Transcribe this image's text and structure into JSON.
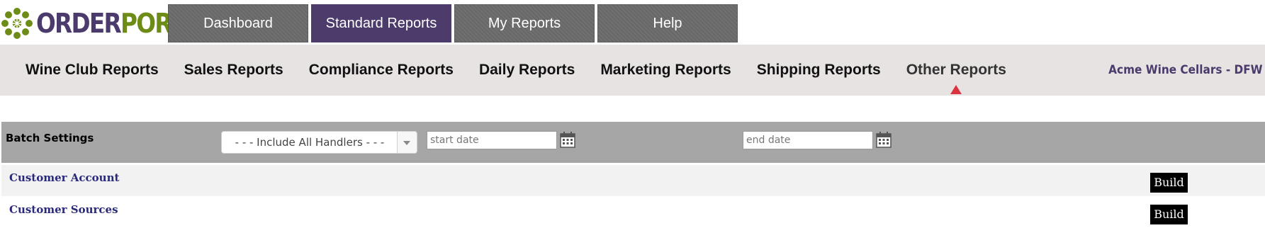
{
  "brand": {
    "name_part1": "ORDER",
    "name_part2": "PORT",
    "color_purple": "#4b3a6c",
    "color_green": "#6d8c17"
  },
  "main_tabs": [
    {
      "label": "Dashboard",
      "active": false
    },
    {
      "label": "Standard Reports",
      "active": true
    },
    {
      "label": "My Reports",
      "active": false
    },
    {
      "label": "Help",
      "active": false
    }
  ],
  "sub_nav": [
    {
      "label": "Wine Club Reports"
    },
    {
      "label": "Sales Reports"
    },
    {
      "label": "Compliance Reports"
    },
    {
      "label": "Daily Reports"
    },
    {
      "label": "Marketing Reports"
    },
    {
      "label": "Shipping Reports"
    },
    {
      "label": "Other Reports",
      "active": true
    }
  ],
  "account": {
    "name": "Acme Wine Cellars - DFW"
  },
  "batch": {
    "label": "Batch Settings",
    "handler_selected": "- - - Include All Handlers - - -",
    "start_date_placeholder": "start date",
    "end_date_placeholder": "end date",
    "calendar_icon": "calendar-icon"
  },
  "reports": [
    {
      "name": "Customer Account",
      "button": "Build"
    },
    {
      "name": "Customer Sources",
      "button": "Build"
    }
  ],
  "colors": {
    "active_tab": "#4d3b6b",
    "tab": "#6b6b6b",
    "accent_triangle": "#d9343f",
    "link": "#2a2a7c"
  }
}
